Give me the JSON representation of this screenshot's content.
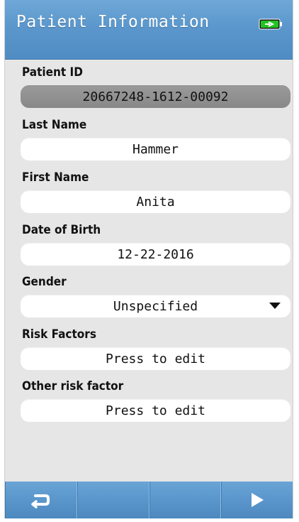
{
  "header": {
    "title": "Patient Information",
    "battery_icon": "battery-charging-icon",
    "battery_color": "#22c322"
  },
  "form": {
    "patient_id": {
      "label": "Patient ID",
      "value": "20667248-1612-00092"
    },
    "last_name": {
      "label": "Last Name",
      "value": "Hammer"
    },
    "first_name": {
      "label": "First Name",
      "value": "Anita"
    },
    "dob": {
      "label": "Date of Birth",
      "value": "12-22-2016"
    },
    "gender": {
      "label": "Gender",
      "value": "Unspecified"
    },
    "risk_factors": {
      "label": "Risk Factors",
      "value": "Press to edit"
    },
    "other_risk": {
      "label": "Other risk factor",
      "value": "Press to edit"
    }
  },
  "toolbar": {
    "back_icon": "return-arrow-icon",
    "next_icon": "play-right-icon",
    "accent": "#5a96cb"
  }
}
